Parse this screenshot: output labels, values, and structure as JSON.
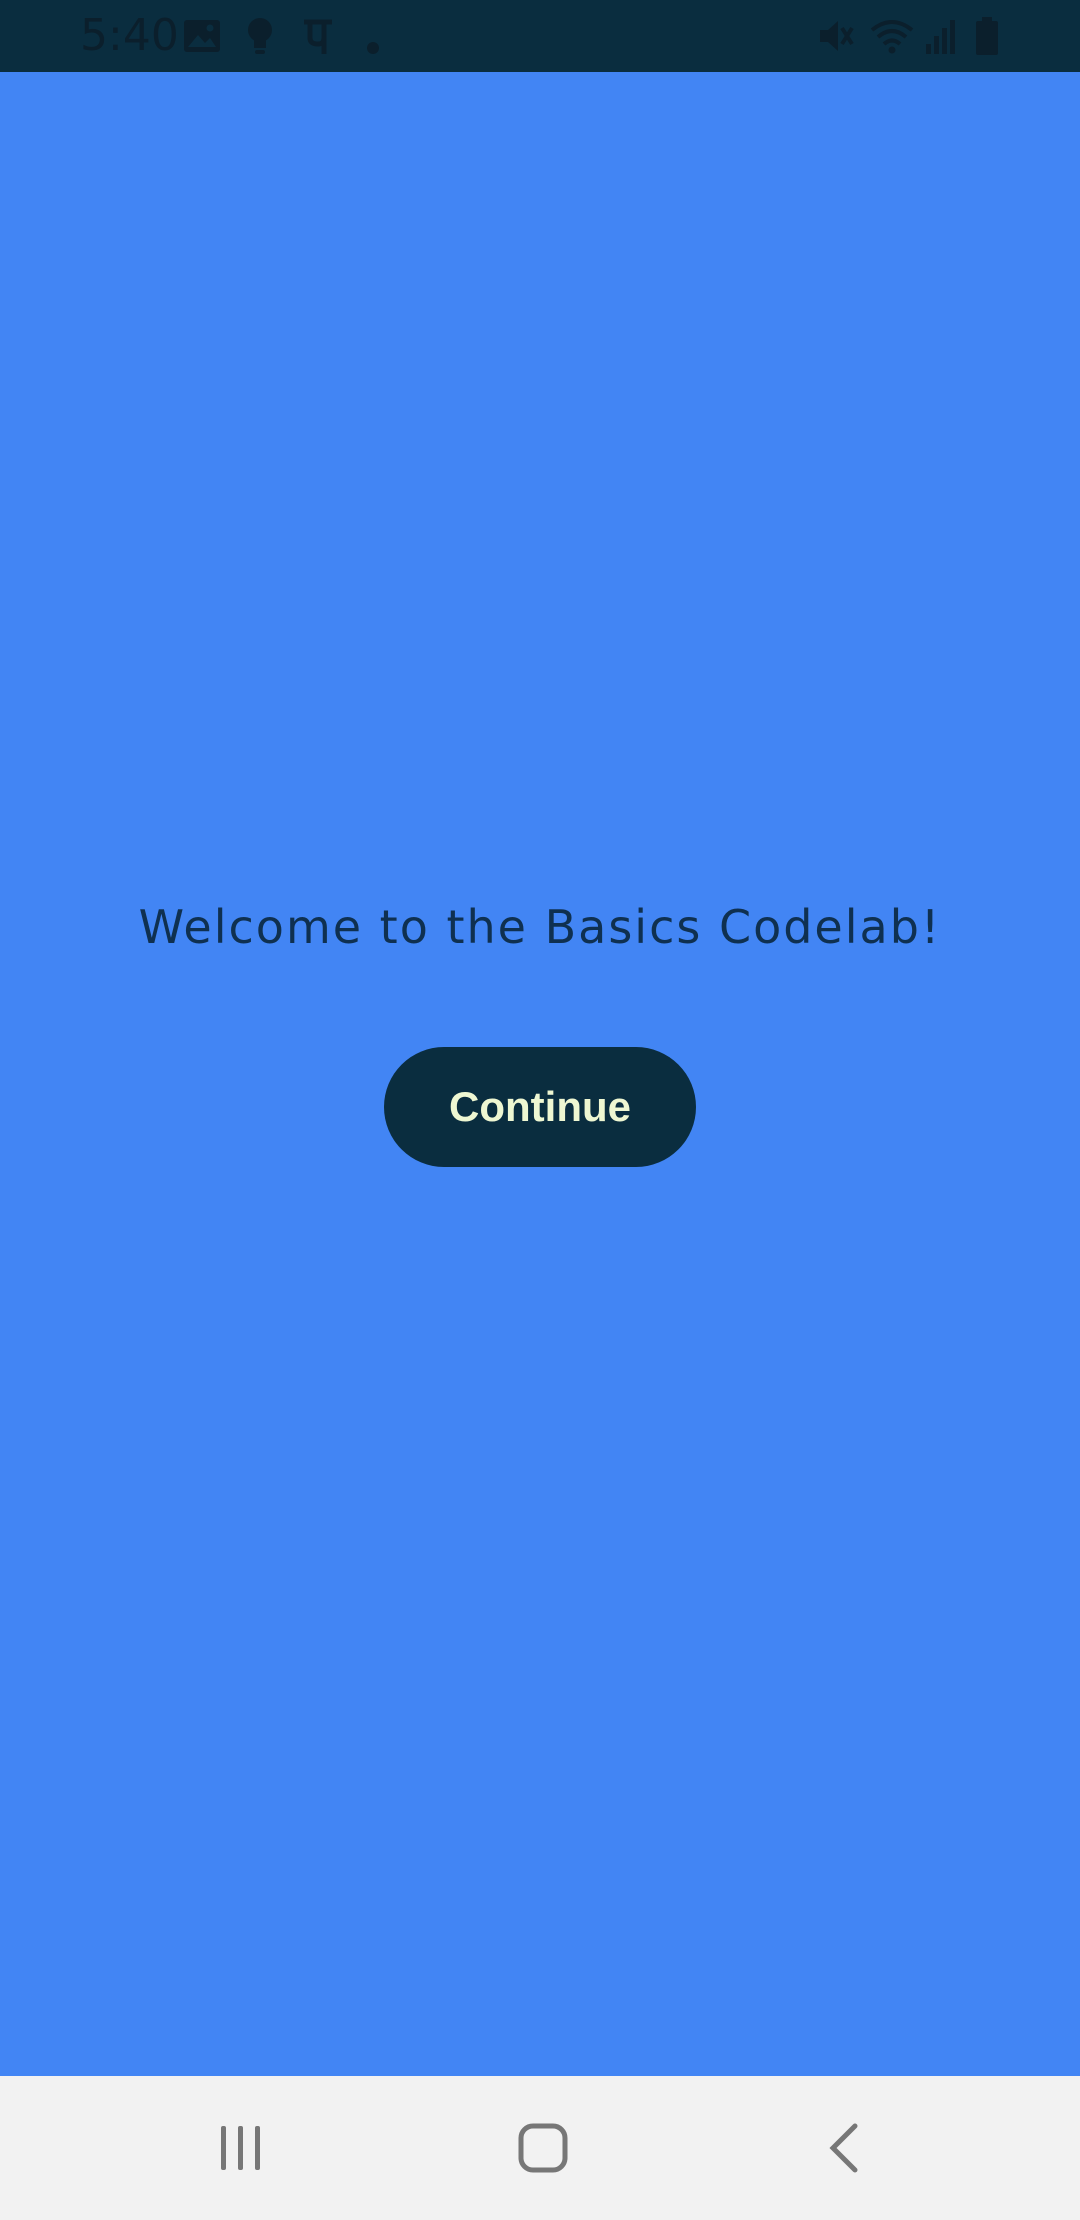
{
  "status_bar": {
    "time": "5:40",
    "icons": [
      "image-icon",
      "bulb-icon",
      "phonepe-icon",
      "dot-icon",
      "mute-icon",
      "wifi-icon",
      "signal-icon",
      "battery-icon"
    ]
  },
  "main": {
    "welcome_text": "Welcome to the Basics Codelab!",
    "continue_label": "Continue"
  },
  "nav_bar": {
    "buttons": [
      "recents-icon",
      "home-icon",
      "back-icon"
    ]
  },
  "colors": {
    "background": "#4285f4",
    "status_bar": "#0a2d3f",
    "button_bg": "#0a2d3f",
    "button_text": "#eef7d2",
    "nav_bar": "#f2f2f2"
  }
}
